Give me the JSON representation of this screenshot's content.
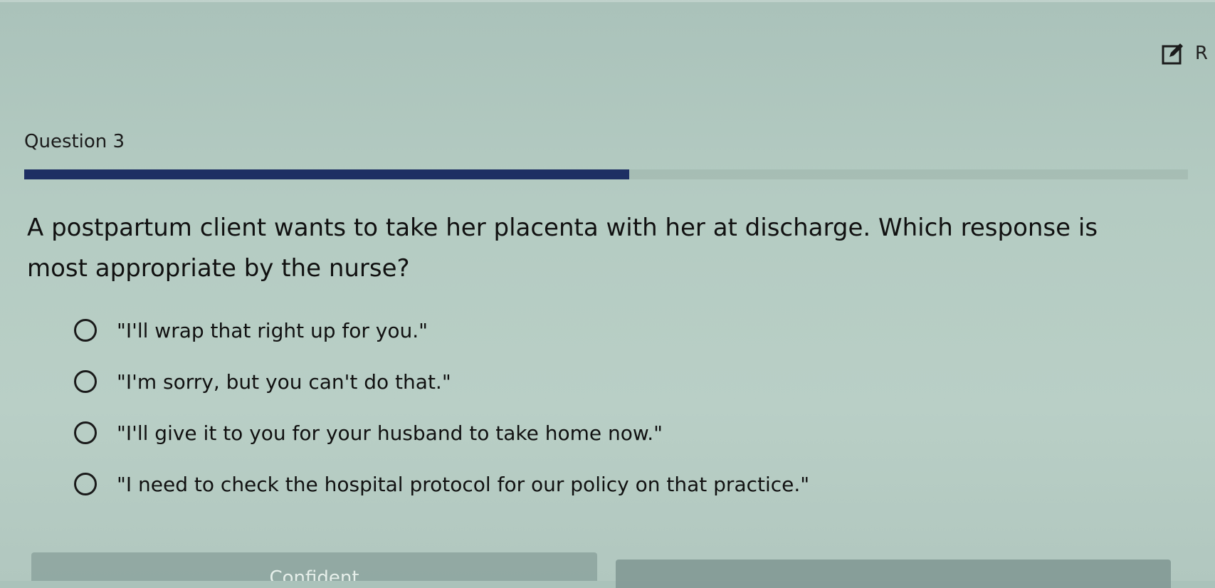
{
  "header": {
    "edit_label": "R"
  },
  "question": {
    "title": "Question 3",
    "progress_percent": 52,
    "text": "A postpartum client wants to take her placenta with her at discharge. Which response is most appropriate by the nurse?"
  },
  "answers": [
    {
      "label": "\"I'll wrap that right up for you.\"",
      "selected": false
    },
    {
      "label": "\"I'm sorry, but you can't do that.\"",
      "selected": false
    },
    {
      "label": "\"I'll give it to you for your husband to take home now.\"",
      "selected": false
    },
    {
      "label": "\"I need to check the hospital protocol for our policy on that practice.\"",
      "selected": false
    }
  ],
  "footer": {
    "confident_label": "Confident"
  },
  "colors": {
    "progress_fill": "#1e2f63"
  },
  "icons": {
    "edit": "edit-pencil-icon",
    "answer": "radio-empty-icon"
  }
}
